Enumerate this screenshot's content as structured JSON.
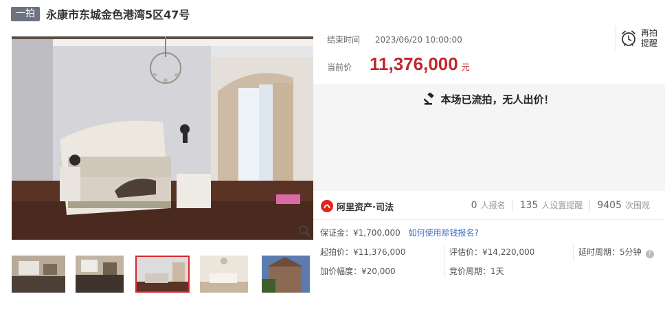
{
  "header": {
    "round_badge": "一拍",
    "title": "永康市东城金色港湾5区47号"
  },
  "auction": {
    "end_time_label": "结束时间",
    "end_time_value": "2023/06/20 10:00:00",
    "current_price_label": "当前价",
    "current_price_value": "11,376,000",
    "current_price_unit": "元",
    "remind_line1": "再拍",
    "remind_line2": "提醒",
    "result_text": "本场已流拍，无人出价！"
  },
  "platform": {
    "logo_text": "阿里资产·司法",
    "stats": [
      {
        "value": "0",
        "label": "人报名"
      },
      {
        "value": "135",
        "label": "人设置提醒"
      },
      {
        "value": "9405",
        "label": "次围观"
      }
    ]
  },
  "details": {
    "deposit": "保证金：¥1,700,000",
    "deposit_link": "如何使用赊钱报名?",
    "start_price": "起拍价：¥11,376,000",
    "assessed_price": "评估价：¥14,220,000",
    "delay_period": "延时周期：5分钟",
    "increment": "加价幅度：¥20,000",
    "bid_period": "竞价周期：1天"
  },
  "colors": {
    "price_red": "#c1272d",
    "link_blue": "#3a6fbf",
    "thumb_selected": "#d9282b"
  }
}
